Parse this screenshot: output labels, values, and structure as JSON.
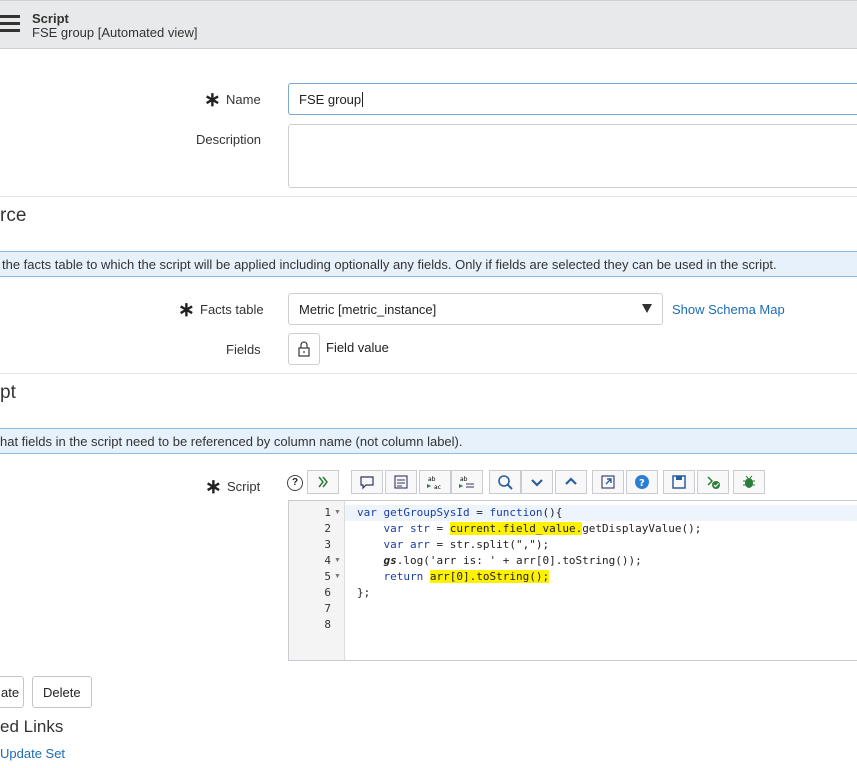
{
  "header": {
    "title": "Script",
    "subtitle": "FSE group [Automated view]"
  },
  "form": {
    "name_label": "Name",
    "name_value": "FSE group",
    "description_label": "Description",
    "description_value": ""
  },
  "source_section": {
    "title": "rce",
    "banner": "the facts table to which the script will be applied including optionally any fields. Only if fields are selected they can be used in the script.",
    "facts_label": "Facts table",
    "facts_value": "Metric [metric_instance]",
    "schema_link": "Show Schema Map",
    "fields_label": "Fields",
    "fields_value": "Field value"
  },
  "script_section": {
    "title": "pt",
    "banner": "hat fields in the script need to be referenced by column name (not column label).",
    "script_label": "Script",
    "help_glyph": "?",
    "code_lines": [
      {
        "num": "1",
        "fold": true
      },
      {
        "num": "2",
        "fold": false
      },
      {
        "num": "3",
        "fold": false
      },
      {
        "num": "4",
        "fold": true
      },
      {
        "num": "5",
        "fold": true
      },
      {
        "num": "6",
        "fold": false
      },
      {
        "num": "7",
        "fold": false
      },
      {
        "num": "8",
        "fold": false
      }
    ],
    "code": {
      "l1_a": "var ",
      "l1_b": "getGroupSysId",
      "l1_c": " = ",
      "l1_d": "function",
      "l1_e": "(){",
      "l2_a": "    var ",
      "l2_b": "str",
      "l2_c": " = ",
      "l2_d": "current.field_value.",
      "l2_e": "getDisplayValue();",
      "l3_a": "    var ",
      "l3_b": "arr",
      "l3_c": " = str.split(\",\");",
      "l4_a": "    gs",
      "l4_b": ".log('arr is: ' + arr[0].toString());",
      "l5_a": "    return ",
      "l5_b": "arr[0].toString();",
      "l6_a": "};"
    }
  },
  "buttons": {
    "update_partial": "ate",
    "delete": "Delete"
  },
  "related": {
    "title": "ed Links",
    "update_set": "Update Set"
  },
  "colors": {
    "accent": "#1c6cb6",
    "banner_bg": "#e7f1fb",
    "highlight": "#fff200"
  }
}
